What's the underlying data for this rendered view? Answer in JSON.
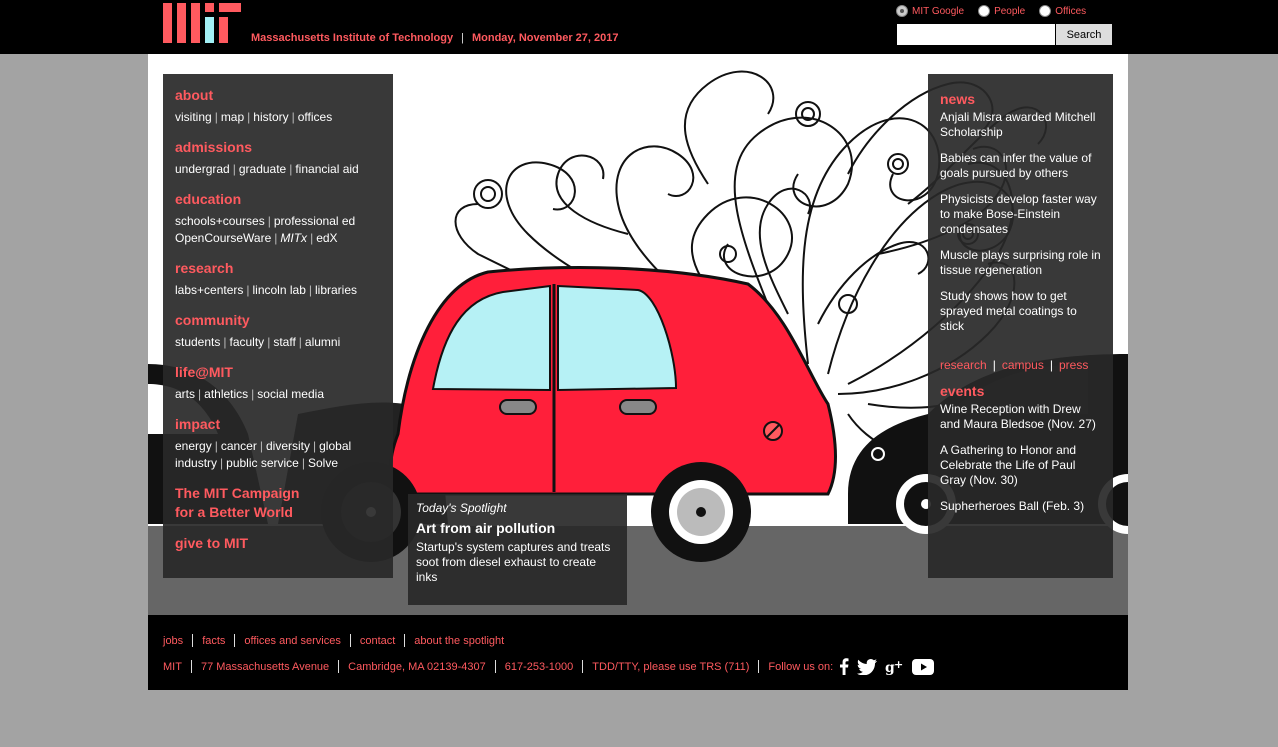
{
  "header": {
    "institute_name": "Massachusetts Institute of Technology",
    "date": "Monday, November 27, 2017",
    "search": {
      "options": [
        "MIT Google",
        "People",
        "Offices"
      ],
      "selected": "MIT Google",
      "value": "",
      "button_label": "Search"
    }
  },
  "nav": {
    "sections": [
      {
        "title": "about",
        "links": [
          "visiting",
          "map",
          "history",
          "offices"
        ]
      },
      {
        "title": "admissions",
        "links": [
          "undergrad",
          "graduate",
          "financial aid"
        ]
      },
      {
        "title": "education",
        "links": [
          "schools+courses",
          "professional ed"
        ],
        "links2": [
          "OpenCourseWare",
          "MITx",
          "edX"
        ]
      },
      {
        "title": "research",
        "links": [
          "labs+centers",
          "lincoln lab",
          "libraries"
        ]
      },
      {
        "title": "community",
        "links": [
          "students",
          "faculty",
          "staff",
          "alumni"
        ]
      },
      {
        "title": "life@MIT",
        "links": [
          "arts",
          "athletics",
          "social media"
        ]
      },
      {
        "title": "impact",
        "links": [
          "energy",
          "cancer",
          "diversity",
          "global"
        ],
        "links2": [
          "industry",
          "public service",
          "Solve"
        ]
      }
    ],
    "campaign_line1": "The MIT Campaign",
    "campaign_line2": "for a Better World",
    "give": "give to MIT"
  },
  "spotlight": {
    "label": "Today's Spotlight",
    "title": "Art from air pollution",
    "description": "Startup's system captures and treats soot from diesel exhaust to create inks"
  },
  "news": {
    "title": "news",
    "items": [
      "Anjali Misra awarded Mitchell Scholarship",
      "Babies can infer the value of goals pursued by others",
      "Physicists develop faster way to make Bose-Einstein condensates",
      "Muscle plays surprising role in tissue regeneration",
      "Study shows how to get sprayed metal coatings to stick"
    ],
    "links": [
      "research",
      "campus",
      "press"
    ]
  },
  "events": {
    "title": "events",
    "items": [
      "Wine Reception with Drew and Maura Bledsoe (Nov. 27)",
      "A Gathering to Honor and Celebrate the Life of Paul Gray (Nov. 30)",
      "Supherheroes Ball (Feb. 3)"
    ]
  },
  "footer": {
    "row1": [
      "jobs",
      "facts",
      "offices and services",
      "contact",
      "about the spotlight"
    ],
    "row2": [
      "MIT",
      "77 Massachusetts Avenue",
      "Cambridge, MA 02139-4307",
      "617-253-1000",
      "TDD/TTY, please use TRS (711)"
    ],
    "follow": "Follow us on:",
    "social": [
      "facebook-icon",
      "twitter-icon",
      "google-plus-icon",
      "youtube-icon"
    ]
  },
  "colors": {
    "accent": "#ff5a5f",
    "car_red": "#ff1f3a",
    "panel": "#282828"
  }
}
